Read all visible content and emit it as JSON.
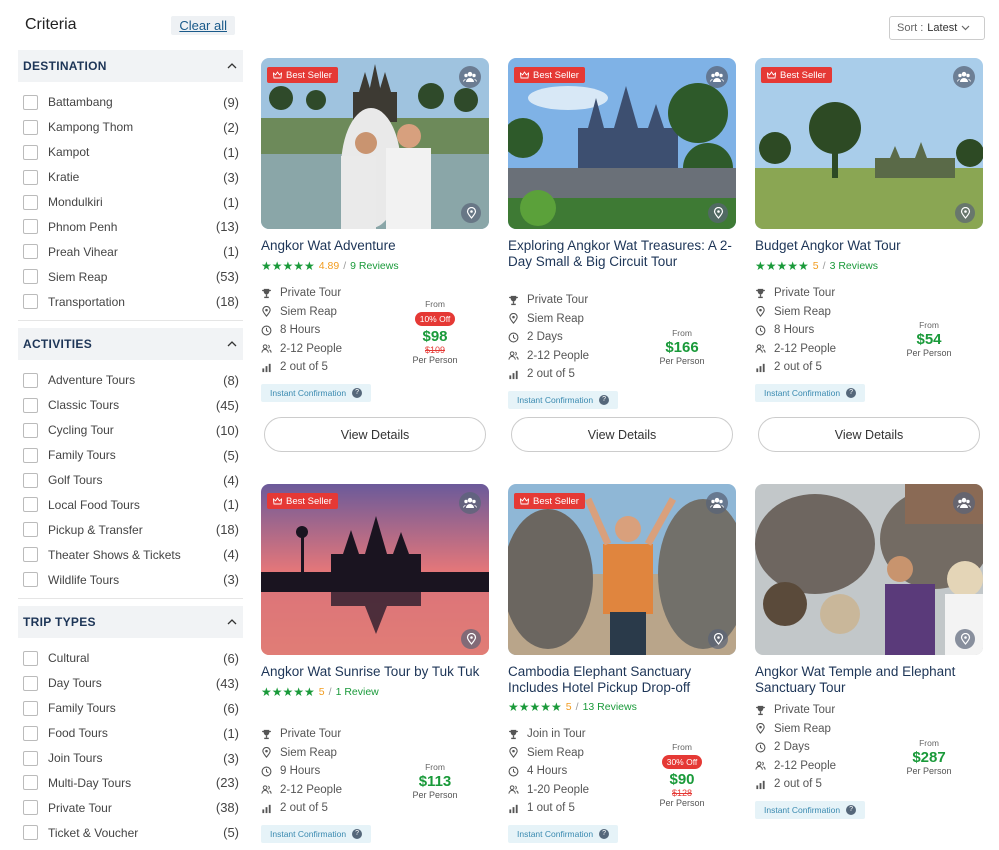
{
  "sidebar": {
    "title": "Criteria",
    "clear_all": "Clear all",
    "sections": [
      {
        "title": "DESTINATION",
        "options": [
          {
            "label": "Battambang",
            "count": "(9)"
          },
          {
            "label": "Kampong Thom",
            "count": "(2)"
          },
          {
            "label": "Kampot",
            "count": "(1)"
          },
          {
            "label": "Kratie",
            "count": "(3)"
          },
          {
            "label": "Mondulkiri",
            "count": "(1)"
          },
          {
            "label": "Phnom Penh",
            "count": "(13)"
          },
          {
            "label": "Preah Vihear",
            "count": "(1)"
          },
          {
            "label": "Siem Reap",
            "count": "(53)"
          },
          {
            "label": "Transportation",
            "count": "(18)"
          }
        ]
      },
      {
        "title": "ACTIVITIES",
        "options": [
          {
            "label": "Adventure Tours",
            "count": "(8)"
          },
          {
            "label": "Classic Tours",
            "count": "(45)"
          },
          {
            "label": "Cycling Tour",
            "count": "(10)"
          },
          {
            "label": "Family Tours",
            "count": "(5)"
          },
          {
            "label": "Golf Tours",
            "count": "(4)"
          },
          {
            "label": "Local Food Tours",
            "count": "(1)"
          },
          {
            "label": "Pickup & Transfer",
            "count": "(18)"
          },
          {
            "label": "Theater Shows & Tickets",
            "count": "(4)"
          },
          {
            "label": "Wildlife Tours",
            "count": "(3)"
          }
        ]
      },
      {
        "title": "TRIP TYPES",
        "options": [
          {
            "label": "Cultural",
            "count": "(6)"
          },
          {
            "label": "Day Tours",
            "count": "(43)"
          },
          {
            "label": "Family Tours",
            "count": "(6)"
          },
          {
            "label": "Food Tours",
            "count": "(1)"
          },
          {
            "label": "Join Tours",
            "count": "(3)"
          },
          {
            "label": "Multi-Day Tours",
            "count": "(23)"
          },
          {
            "label": "Private Tour",
            "count": "(38)"
          },
          {
            "label": "Ticket & Voucher",
            "count": "(5)"
          }
        ]
      }
    ]
  },
  "sort": {
    "label": "Sort :",
    "value": "Latest"
  },
  "colors": {
    "accent_green": "#1a9a3a",
    "badge_red": "#e53935",
    "title_navy": "#1d3557",
    "rating_orange": "#f29c1f"
  },
  "tours": [
    {
      "title": "Angkor Wat Adventure",
      "best_seller": "Best Seller",
      "stars": "★★★★★",
      "rating": "4.89",
      "reviews": "9 Reviews",
      "type": "Private Tour",
      "location": "Siem Reap",
      "duration": "8 Hours",
      "people": "2-12 People",
      "level": "2 out of 5",
      "from": "From",
      "discount": "10% Off",
      "price": "$98",
      "old_price": "$109",
      "per": "Per Person",
      "instant": "Instant Confirmation",
      "button": "View Details"
    },
    {
      "title": "Exploring Angkor Wat Treasures: A 2-Day Small & Big Circuit Tour",
      "best_seller": "Best Seller",
      "type": "Private Tour",
      "location": "Siem Reap",
      "duration": "2 Days",
      "people": "2-12 People",
      "level": "2 out of 5",
      "from": "From",
      "price": "$166",
      "per": "Per Person",
      "instant": "Instant Confirmation",
      "button": "View Details"
    },
    {
      "title": "Budget Angkor Wat Tour",
      "best_seller": "Best Seller",
      "stars": "★★★★★",
      "rating": "5",
      "reviews": "3 Reviews",
      "type": "Private Tour",
      "location": "Siem Reap",
      "duration": "8 Hours",
      "people": "2-12 People",
      "level": "2 out of 5",
      "from": "From",
      "price": "$54",
      "per": "Per Person",
      "instant": "Instant Confirmation",
      "button": "View Details"
    },
    {
      "title": "Angkor Wat Sunrise Tour by Tuk Tuk",
      "best_seller": "Best Seller",
      "stars": "★★★★★",
      "rating": "5",
      "reviews": "1 Review",
      "type": "Private Tour",
      "location": "Siem Reap",
      "duration": "9 Hours",
      "people": "2-12 People",
      "level": "2 out of 5",
      "from": "From",
      "price": "$113",
      "per": "Per Person",
      "instant": "Instant Confirmation"
    },
    {
      "title": "Cambodia Elephant Sanctuary Includes Hotel Pickup Drop-off",
      "best_seller": "Best Seller",
      "stars": "★★★★★",
      "rating": "5",
      "reviews": "13 Reviews",
      "type": "Join in Tour",
      "location": "Siem Reap",
      "duration": "4 Hours",
      "people": "1-20 People",
      "level": "1 out of 5",
      "from": "From",
      "discount": "30% Off",
      "price": "$90",
      "old_price": "$128",
      "per": "Per Person",
      "instant": "Instant Confirmation"
    },
    {
      "title": "Angkor Wat Temple and Elephant Sanctuary Tour",
      "type": "Private Tour",
      "location": "Siem Reap",
      "duration": "2 Days",
      "people": "2-12 People",
      "level": "2 out of 5",
      "from": "From",
      "price": "$287",
      "per": "Per Person",
      "instant": "Instant Confirmation"
    }
  ]
}
